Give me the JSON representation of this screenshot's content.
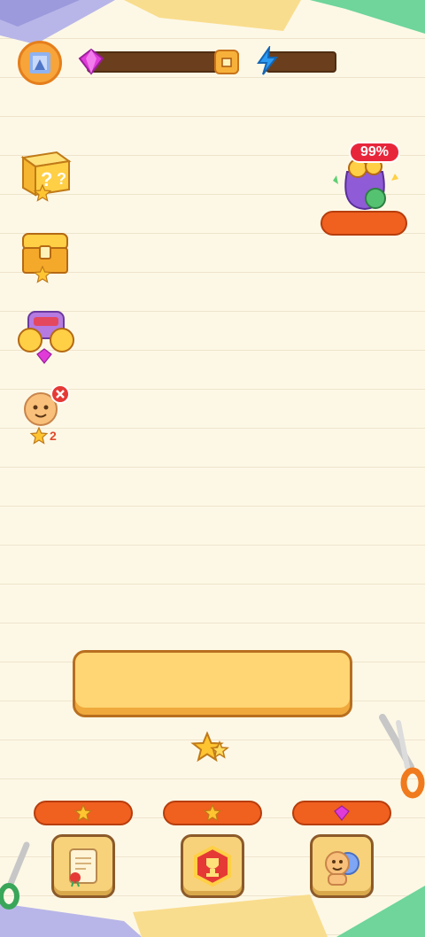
{
  "hud": {
    "gem_icon": "gem-icon",
    "energy_icon": "lightning-icon",
    "gem_value": "",
    "energy_value": ""
  },
  "promo": {
    "percent_label": "99%",
    "button_label": ""
  },
  "side_items": [
    {
      "name": "mystery-box",
      "badge": ""
    },
    {
      "name": "treasure-chest",
      "badge": ""
    },
    {
      "name": "coin-purse",
      "badge": ""
    },
    {
      "name": "character-reward",
      "badge": "2"
    }
  ],
  "main_button": {
    "label": ""
  },
  "bottom_nav": [
    {
      "name": "scroll-quests",
      "cost_icon": "star-icon"
    },
    {
      "name": "trophy-events",
      "cost_icon": "star-icon"
    },
    {
      "name": "characters",
      "cost_icon": "gem-icon"
    }
  ],
  "colors": {
    "background": "#fdf8e6",
    "accent_orange": "#f0601f",
    "button_yellow": "#ffd673",
    "gem_pink": "#e03bd8",
    "energy_blue": "#2b9af3"
  }
}
